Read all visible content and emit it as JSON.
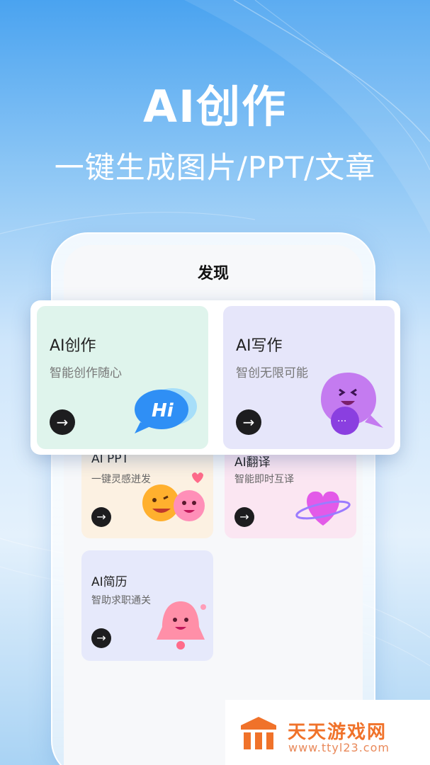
{
  "hero": {
    "title": "AI创作",
    "subtitle": "一键生成图片/PPT/文章"
  },
  "screen": {
    "title": "发现"
  },
  "featured_cards": [
    {
      "title": "AI创作",
      "subtitle": "智能创作随心",
      "badge": "Hi",
      "bg": "#dff4ec"
    },
    {
      "title": "AI写作",
      "subtitle": "智创无限可能",
      "badge": "···",
      "bg": "#e6e6fa"
    }
  ],
  "cards": [
    {
      "title": "AI PPT",
      "subtitle": "一键灵感迸发",
      "bg": "#fcf1e2"
    },
    {
      "title": "AI翻译",
      "subtitle": "智能即时互译",
      "bg": "#fbe6f2"
    },
    {
      "title": "AI简历",
      "subtitle": "智助求职通关",
      "bg": "#e6e9fb"
    }
  ],
  "icons": {
    "arrow": "arrow-right-icon"
  },
  "watermark": {
    "title": "天天游戏网",
    "url": "www.ttyl23.com"
  }
}
